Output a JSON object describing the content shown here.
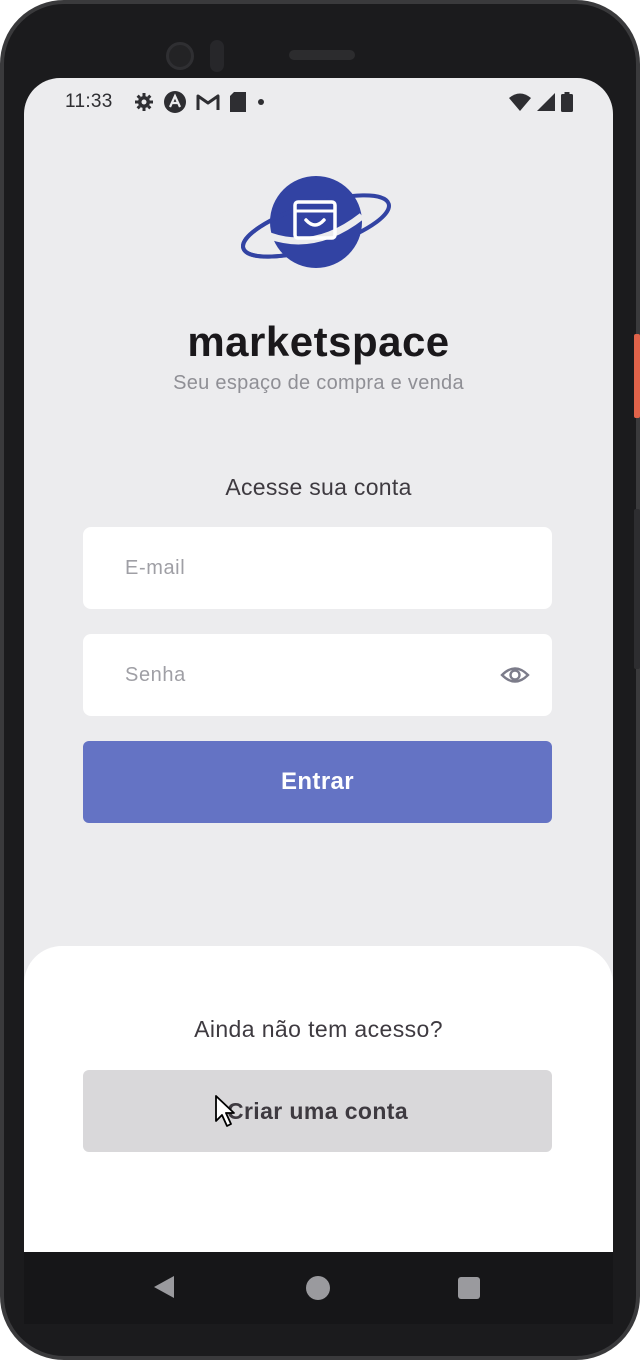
{
  "status_bar": {
    "time": "11:33",
    "left_icons": [
      "gear-icon",
      "app-a-icon",
      "gmail-icon",
      "sd-card-icon",
      "dot-icon"
    ],
    "right_icons": [
      "wifi-icon",
      "signal-icon",
      "battery-icon"
    ]
  },
  "brand": {
    "name": "marketspace",
    "tagline": "Seu espaço de compra e venda",
    "logo_color": "#3243a3"
  },
  "login": {
    "heading": "Acesse sua conta",
    "email_placeholder": "E-mail",
    "password_placeholder": "Senha",
    "submit_label": "Entrar",
    "submit_color": "#6473c4"
  },
  "signup": {
    "prompt": "Ainda não tem acesso?",
    "create_label": "Criar uma conta"
  },
  "navigation": {
    "buttons": [
      "back-icon",
      "home-icon",
      "recents-icon"
    ]
  }
}
